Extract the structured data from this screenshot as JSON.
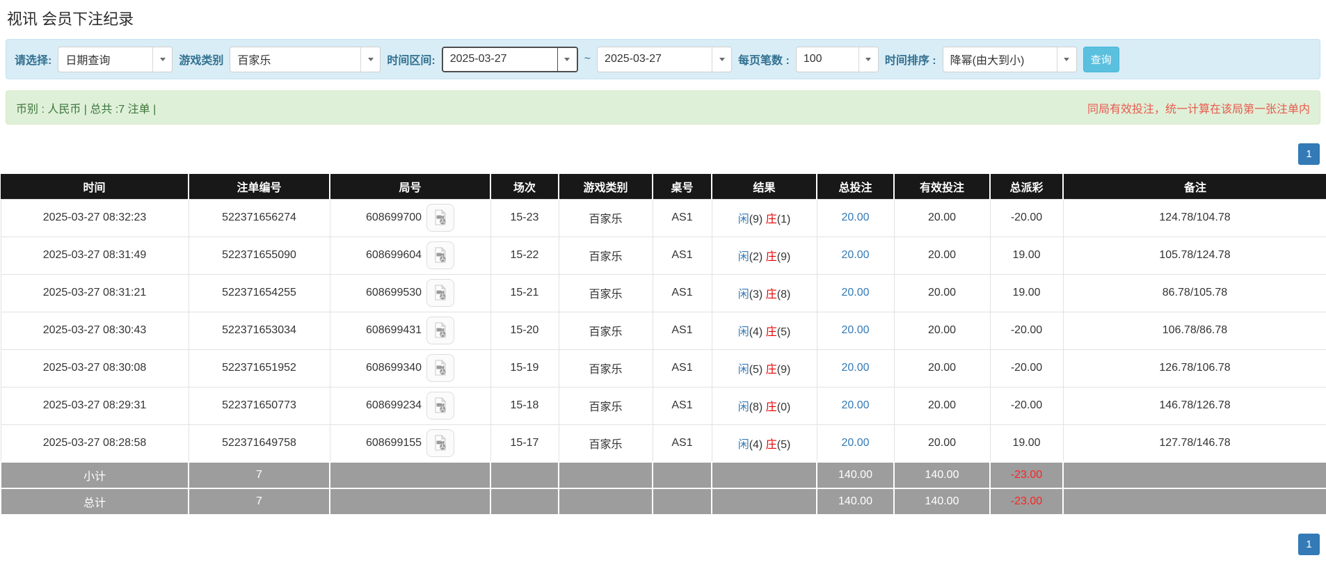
{
  "page": {
    "title": "视讯 会员下注纪录"
  },
  "filters": {
    "select_type": {
      "label": "请选择:",
      "value": "日期查询"
    },
    "game_category": {
      "label": "游戏类别",
      "value": "百家乐"
    },
    "time_range": {
      "label": "时间区间:",
      "from": "2025-03-27",
      "separator": "~",
      "to": "2025-03-27"
    },
    "page_size": {
      "label": "每页笔数 :",
      "value": "100"
    },
    "time_sort": {
      "label": "时间排序 :",
      "value": "降幂(由大到小)"
    },
    "search_button": "查询"
  },
  "summary_bar": {
    "left": "币别 : 人民币 | 总共 :7 注单 |",
    "right": "同局有效投注，统一计算在该局第一张注单内"
  },
  "pagination": {
    "page": "1"
  },
  "table": {
    "headers": [
      "时间",
      "注单编号",
      "局号",
      "场次",
      "游戏类别",
      "桌号",
      "结果",
      "总投注",
      "有效投注",
      "总派彩",
      "备注"
    ],
    "rows": [
      {
        "time": "2025-03-27 08:32:23",
        "bet_id": "522371656274",
        "round_id": "608699700",
        "session": "15-23",
        "game": "百家乐",
        "table_no": "AS1",
        "result_player": "闲",
        "result_player_score": "(9)",
        "result_banker": "庄",
        "result_banker_score": "(1)",
        "total_bet": "20.00",
        "valid_bet": "20.00",
        "payout": "-20.00",
        "remark": "124.78/104.78"
      },
      {
        "time": "2025-03-27 08:31:49",
        "bet_id": "522371655090",
        "round_id": "608699604",
        "session": "15-22",
        "game": "百家乐",
        "table_no": "AS1",
        "result_player": "闲",
        "result_player_score": "(2)",
        "result_banker": "庄",
        "result_banker_score": "(9)",
        "total_bet": "20.00",
        "valid_bet": "20.00",
        "payout": "19.00",
        "remark": "105.78/124.78"
      },
      {
        "time": "2025-03-27 08:31:21",
        "bet_id": "522371654255",
        "round_id": "608699530",
        "session": "15-21",
        "game": "百家乐",
        "table_no": "AS1",
        "result_player": "闲",
        "result_player_score": "(3)",
        "result_banker": "庄",
        "result_banker_score": "(8)",
        "total_bet": "20.00",
        "valid_bet": "20.00",
        "payout": "19.00",
        "remark": "86.78/105.78"
      },
      {
        "time": "2025-03-27 08:30:43",
        "bet_id": "522371653034",
        "round_id": "608699431",
        "session": "15-20",
        "game": "百家乐",
        "table_no": "AS1",
        "result_player": "闲",
        "result_player_score": "(4)",
        "result_banker": "庄",
        "result_banker_score": "(5)",
        "total_bet": "20.00",
        "valid_bet": "20.00",
        "payout": "-20.00",
        "remark": "106.78/86.78"
      },
      {
        "time": "2025-03-27 08:30:08",
        "bet_id": "522371651952",
        "round_id": "608699340",
        "session": "15-19",
        "game": "百家乐",
        "table_no": "AS1",
        "result_player": "闲",
        "result_player_score": "(5)",
        "result_banker": "庄",
        "result_banker_score": "(9)",
        "total_bet": "20.00",
        "valid_bet": "20.00",
        "payout": "-20.00",
        "remark": "126.78/106.78"
      },
      {
        "time": "2025-03-27 08:29:31",
        "bet_id": "522371650773",
        "round_id": "608699234",
        "session": "15-18",
        "game": "百家乐",
        "table_no": "AS1",
        "result_player": "闲",
        "result_player_score": "(8)",
        "result_banker": "庄",
        "result_banker_score": "(0)",
        "total_bet": "20.00",
        "valid_bet": "20.00",
        "payout": "-20.00",
        "remark": "146.78/126.78"
      },
      {
        "time": "2025-03-27 08:28:58",
        "bet_id": "522371649758",
        "round_id": "608699155",
        "session": "15-17",
        "game": "百家乐",
        "table_no": "AS1",
        "result_player": "闲",
        "result_player_score": "(4)",
        "result_banker": "庄",
        "result_banker_score": "(5)",
        "total_bet": "20.00",
        "valid_bet": "20.00",
        "payout": "19.00",
        "remark": "127.78/146.78"
      }
    ],
    "subtotal": {
      "label": "小计",
      "count": "7",
      "total_bet": "140.00",
      "valid_bet": "140.00",
      "payout": "-23.00"
    },
    "total": {
      "label": "总计",
      "count": "7",
      "total_bet": "140.00",
      "valid_bet": "140.00",
      "payout": "-23.00"
    }
  },
  "icons": {
    "video_replay": "video-file-icon",
    "dropdown": "chevron-down-icon"
  },
  "colors": {
    "filter_bar_bg": "#d9edf7",
    "filter_label": "#31708f",
    "query_button": "#5bc0de",
    "summary_bar_bg": "#dff0d8",
    "summary_text_green": "#3c763d",
    "summary_text_red": "#e9594c",
    "pagination_active": "#337ab7",
    "header_bg": "#181818",
    "link_blue": "#337ab7",
    "player_blue": "#337ab7",
    "banker_red": "#e60000",
    "negative_red": "#f21111",
    "summary_row_bg": "#9d9d9d"
  }
}
